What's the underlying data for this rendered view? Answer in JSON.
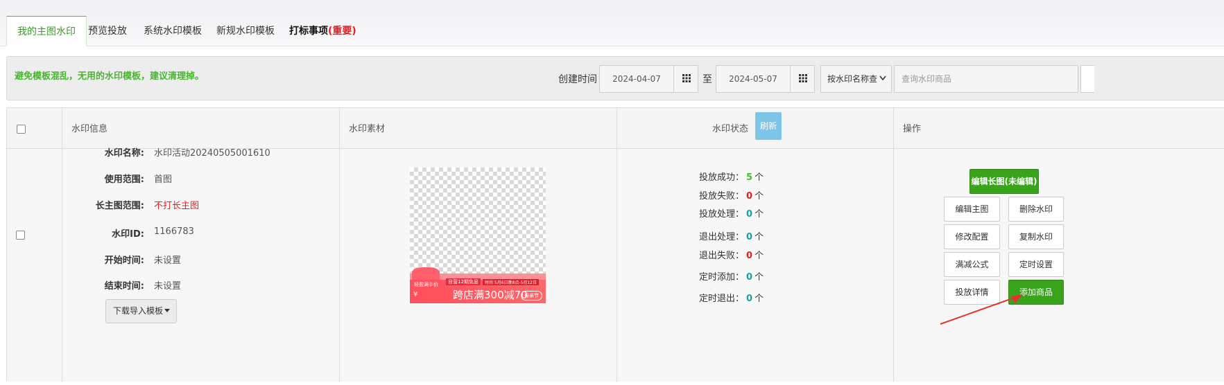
{
  "tabs": [
    {
      "label": "我的主图水印"
    },
    {
      "label": "预览投放"
    },
    {
      "label": "系统水印模板"
    },
    {
      "label": "新规水印模板"
    },
    {
      "label": "打标事项",
      "extra": "(重要)"
    }
  ],
  "filter": {
    "notice": "避免模板混乱，无用的水印模板，建议清理掉。",
    "created_label": "创建时间",
    "start_date": "2024-04-07",
    "to_label": "至",
    "end_date": "2024-05-07",
    "select_value": "按水印名称查",
    "search_placeholder": "查询水印商品"
  },
  "table": {
    "headers": {
      "info": "水印信息",
      "material": "水印素材",
      "status": "水印状态",
      "refresh": "刷新",
      "ops": "操作"
    },
    "row": {
      "fields": [
        {
          "key": "水印名称:",
          "value": "水印活动20240505001610"
        },
        {
          "key": "使用范围:",
          "value": "首图"
        },
        {
          "key": "长主图范围:",
          "value": "不打长主图"
        },
        {
          "key": "水印ID:",
          "value": "1166783"
        },
        {
          "key": "开始时间:",
          "value": "未设置"
        },
        {
          "key": "结束时间:",
          "value": "未设置"
        }
      ],
      "download_template": "下载导入模板",
      "image_text": {
        "tag_a": "轻盈满手价",
        "tag_b": "自营12期免息",
        "tag_c": "时间 5月6日晚8点-5月12日",
        "yen": "¥",
        "main": "跨店满300减70",
        "tag_d": "母亲节"
      },
      "status": [
        {
          "label": "投放成功：",
          "count": "5",
          "unit": "个"
        },
        {
          "label": "投放失败：",
          "count": "0",
          "unit": "个"
        },
        {
          "label": "投放处理：",
          "count": "0",
          "unit": "个"
        },
        {
          "label": "退出处理：",
          "count": "0",
          "unit": "个"
        },
        {
          "label": "退出失败：",
          "count": "0",
          "unit": "个"
        },
        {
          "label": "定时添加：",
          "count": "0",
          "unit": "个"
        },
        {
          "label": "定时退出：",
          "count": "0",
          "unit": "个"
        }
      ],
      "ops": {
        "edit_long": "编辑长图(未编辑)",
        "edit_main": "编辑主图",
        "delete": "删除水印",
        "modify": "修改配置",
        "copy": "复制水印",
        "formula": "满减公式",
        "timer": "定时设置",
        "detail": "投放详情",
        "add_goods": "添加商品"
      }
    }
  },
  "colors": {
    "accent_green": "#3aa31c",
    "refresh_blue": "#7cc5e8",
    "red": "#e02020"
  }
}
